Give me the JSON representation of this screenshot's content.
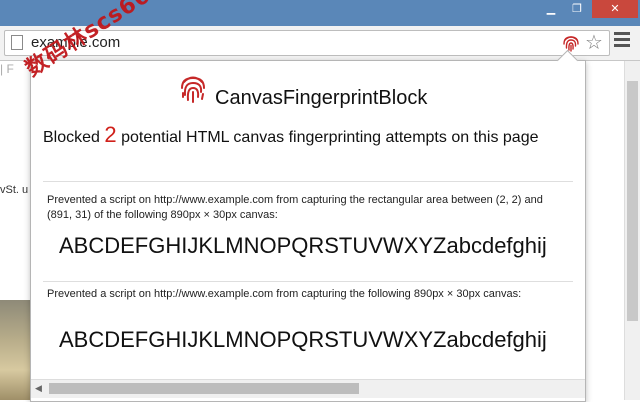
{
  "window": {
    "min_glyph": "▁",
    "max_glyph": "❐",
    "close_glyph": "✕"
  },
  "omnibox": {
    "url": "example.com"
  },
  "toolbar": {
    "star_glyph": "☆"
  },
  "background_page": {
    "separator": "|  F",
    "snippet": "vSt. u"
  },
  "watermark": {
    "text": "数码林scs66"
  },
  "popup": {
    "title": "CanvasFingerprintBlock",
    "blocked_prefix": "Blocked",
    "blocked_count": "2",
    "blocked_suffix": "potential HTML canvas fingerprinting attempts on this page",
    "entries": [
      {
        "description": "Prevented a script on http://www.example.com from capturing the rectangular area between (2, 2) and (891, 31) of the following 890px × 30px canvas:",
        "sample": "ABCDEFGHIJKLMNOPQRSTUVWXYZabcdefghij"
      },
      {
        "description": "Prevented a script on http://www.example.com from capturing the following 890px × 30px canvas:",
        "sample": "ABCDEFGHIJKLMNOPQRSTUVWXYZabcdefghij"
      }
    ],
    "scroll_left_glyph": "◀"
  },
  "colors": {
    "accent_red": "#d0201a",
    "titlebar": "#5a87b8",
    "close_button": "#c9483d"
  },
  "icons": [
    "page-icon",
    "fingerprint-icon",
    "star-icon",
    "menu-icon",
    "minimize-icon",
    "maximize-icon",
    "close-icon"
  ]
}
